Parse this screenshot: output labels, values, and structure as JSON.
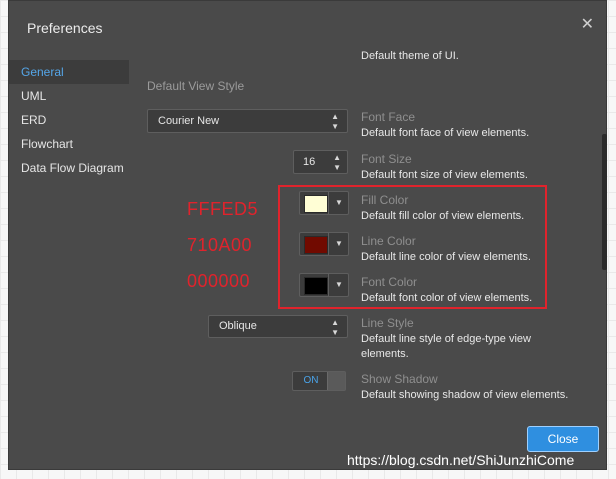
{
  "dialog": {
    "title": "Preferences",
    "close_icon": "close-icon"
  },
  "sidebar": {
    "items": [
      {
        "label": "General",
        "active": true
      },
      {
        "label": "UML",
        "active": false
      },
      {
        "label": "ERD",
        "active": false
      },
      {
        "label": "Flowchart",
        "active": false
      },
      {
        "label": "Data Flow Diagram",
        "active": false
      }
    ]
  },
  "content": {
    "prev_desc": "Default theme of UI.",
    "section_title": "Default View Style",
    "font_face": {
      "value": "Courier New",
      "title": "Font Face",
      "desc": "Default font face of view elements."
    },
    "font_size": {
      "value": "16",
      "title": "Font Size",
      "desc": "Default font size of view elements."
    },
    "fill_color": {
      "value": "#FFFED5",
      "title": "Fill Color",
      "desc": "Default fill color of view elements."
    },
    "line_color": {
      "value": "#710A00",
      "title": "Line Color",
      "desc": "Default line color of view elements."
    },
    "font_color": {
      "value": "#000000",
      "title": "Font Color",
      "desc": "Default font color of view elements."
    },
    "line_style": {
      "value": "Oblique",
      "title": "Line Style",
      "desc1": "Default line style of edge-type view",
      "desc2": "elements."
    },
    "show_shadow": {
      "value": "ON",
      "title": "Show Shadow",
      "desc": "Default showing shadow of view elements."
    }
  },
  "annotations": {
    "fill": "FFFED5",
    "line": "710A00",
    "font": "000000",
    "color": "#e0232c"
  },
  "footer": {
    "close_label": "Close"
  },
  "watermark": "https://blog.csdn.net/ShiJunzhiCome",
  "colors": {
    "dialog_bg": "#4a4a4a",
    "accent": "#2f8fe0",
    "active_nav": "#55a6e8"
  }
}
